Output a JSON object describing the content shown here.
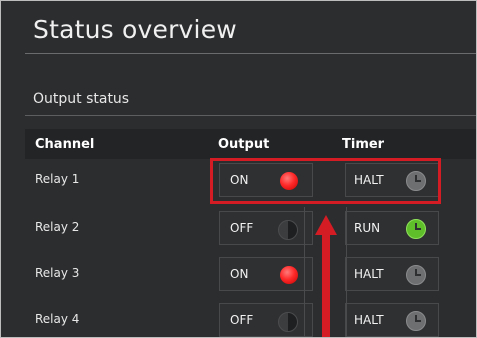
{
  "page": {
    "title": "Status overview"
  },
  "section": {
    "title": "Output status"
  },
  "table": {
    "headers": {
      "channel": "Channel",
      "output": "Output",
      "timer": "Timer"
    },
    "rows": [
      {
        "channel": "Relay 1",
        "output": "ON",
        "output_led": "red",
        "timer": "HALT",
        "timer_icon": "clock-gray-icon"
      },
      {
        "channel": "Relay 2",
        "output": "OFF",
        "output_led": "off",
        "timer": "RUN",
        "timer_icon": "clock-green-icon"
      },
      {
        "channel": "Relay 3",
        "output": "ON",
        "output_led": "red",
        "timer": "HALT",
        "timer_icon": "clock-gray-icon"
      },
      {
        "channel": "Relay 4",
        "output": "OFF",
        "output_led": "off",
        "timer": "HALT",
        "timer_icon": "clock-gray-icon"
      }
    ]
  },
  "colors": {
    "background": "#2c2d2f",
    "led_on": "#ff2a2a",
    "timer_run": "#5fbf2a",
    "annotation": "#d31c24"
  }
}
